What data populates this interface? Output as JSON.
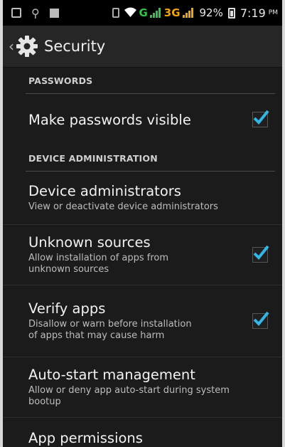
{
  "status_bar": {
    "net_g": "G",
    "net_3g": "3G",
    "battery": "92%",
    "time": "7:19",
    "ampm": "PM"
  },
  "action_bar": {
    "title": "Security",
    "icon": "gear-icon"
  },
  "sections": {
    "passwords": {
      "header": "PASSWORDS",
      "make_visible": {
        "title": "Make passwords visible",
        "checked": true
      }
    },
    "device_admin": {
      "header": "DEVICE ADMINISTRATION",
      "device_admins": {
        "title": "Device administrators",
        "summary": "View or deactivate device administrators"
      },
      "unknown_sources": {
        "title": "Unknown sources",
        "summary": "Allow installation of apps from unknown sources",
        "checked": true
      },
      "verify_apps": {
        "title": "Verify apps",
        "summary": "Disallow or warn before installation of apps that may cause harm",
        "checked": true
      },
      "auto_start": {
        "title": "Auto-start management",
        "summary": "Allow or deny app auto-start during system bootup"
      },
      "app_permissions": {
        "title": "App permissions"
      }
    }
  },
  "colors": {
    "accent_check": "#33b5e5",
    "background": "#1b1b1b"
  }
}
